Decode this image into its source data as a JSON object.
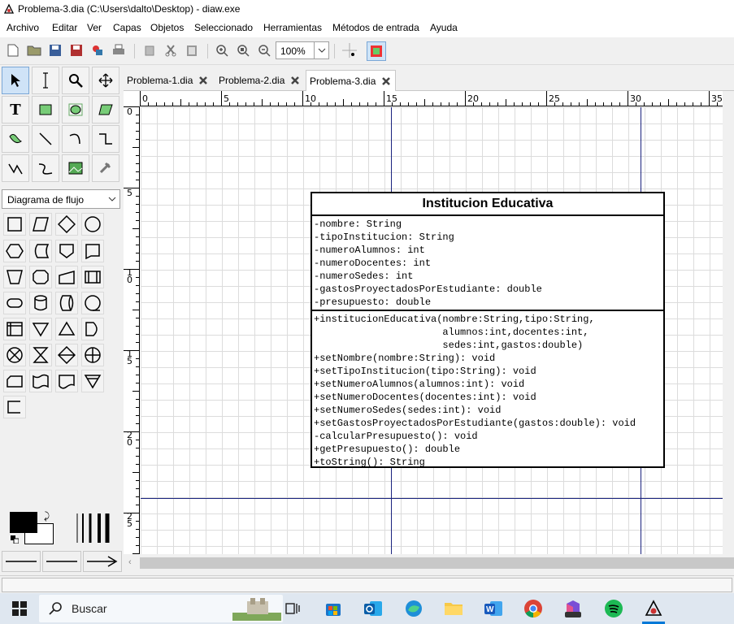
{
  "window": {
    "title": "Problema-3.dia (C:\\Users\\dalto\\Desktop) - diaw.exe"
  },
  "menu": [
    "Archivo",
    "Editar",
    "Ver",
    "Capas",
    "Objetos",
    "Seleccionado",
    "Herramientas",
    "Métodos de entrada",
    "Ayuda"
  ],
  "toolbar": {
    "zoom_value": "100%",
    "icons": [
      "new-file-icon",
      "open-folder-icon",
      "save-icon",
      "save-as-icon",
      "export-icon",
      "print-icon",
      "copy-icon",
      "cut-icon",
      "paste-icon",
      "zoom-in-icon",
      "zoom-fit-icon",
      "zoom-out-icon",
      "zoom-dropdown-icon",
      "snap-grid-icon",
      "snap-object-icon"
    ]
  },
  "tools": [
    "pointer-tool-icon",
    "text-edit-tool-icon",
    "magnify-tool-icon",
    "scroll-tool-icon",
    "text-tool-icon",
    "box-tool-icon",
    "ellipse-tool-icon",
    "polygon-tool-icon",
    "beziergon-tool-icon",
    "line-tool-icon",
    "arc-tool-icon",
    "zigzag-line-tool-icon",
    "polyline-tool-icon",
    "bezier-line-tool-icon",
    "image-tool-icon",
    "outline-tool-icon"
  ],
  "sheet": {
    "selected": "Diagrama de flujo"
  },
  "tabs": [
    {
      "label": "Problema-1.dia",
      "active": false
    },
    {
      "label": "Problema-2.dia",
      "active": false
    },
    {
      "label": "Problema-3.dia",
      "active": true
    }
  ],
  "ruler": {
    "h_labels": [
      "0",
      "5",
      "10",
      "15",
      "20",
      "25",
      "30",
      "35"
    ],
    "v_labels": [
      "0",
      "5",
      "1\n0",
      "1\n5",
      "2\n0",
      "2\n5"
    ]
  },
  "uml_class": {
    "name": "Institucion Educativa",
    "attributes": [
      "-nombre: String",
      "-tipoInstitucion: String",
      "-numeroAlumnos: int",
      "-numeroDocentes: int",
      "-numeroSedes: int",
      "-gastosProyectadosPorEstudiante: double",
      "-presupuesto: double"
    ],
    "operations": [
      "+institucionEducativa(nombre:String,tipo:String,",
      "                      alumnos:int,docentes:int,",
      "                      sedes:int,gastos:double)",
      "+setNombre(nombre:String): void",
      "+setTipoInstitucion(tipo:String): void",
      "+setNumeroAlumnos(alumnos:int): void",
      "+setNumeroDocentes(docentes:int): void",
      "+setNumeroSedes(sedes:int): void",
      "+setGastosProyectadosPorEstudiante(gastos:double): void",
      "-calcularPresupuesto(): void",
      "+getPresupuesto(): double",
      "+toString(): String"
    ]
  },
  "taskbar": {
    "search_label": "Buscar",
    "apps": [
      "task-view-icon",
      "microsoft-store-icon",
      "outlook-icon",
      "edge-icon",
      "file-explorer-icon",
      "word-icon",
      "chrome-icon",
      "m365-icon",
      "spotify-icon",
      "dia-icon"
    ]
  },
  "colors": {
    "page_break_line": "#1a237e",
    "grid": "#dcdcdc",
    "accent": "#0078d7"
  }
}
